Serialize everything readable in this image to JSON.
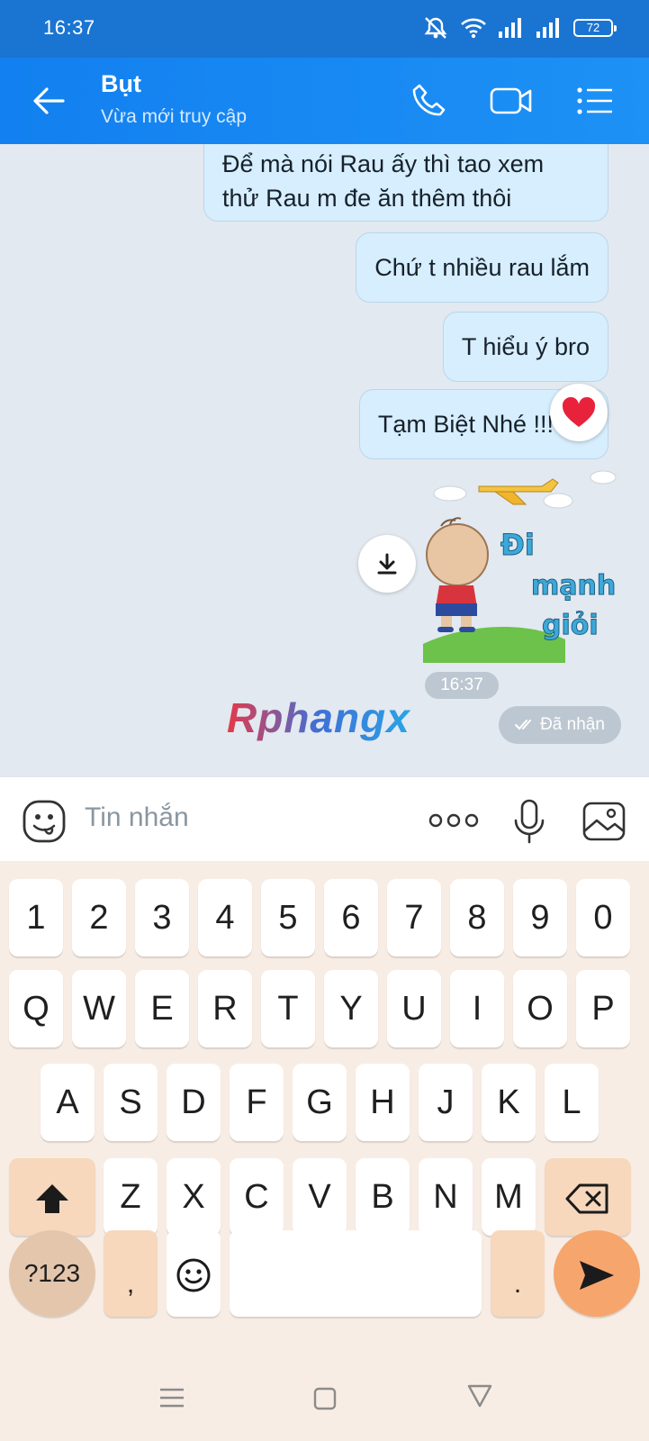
{
  "status_bar": {
    "time": "16:37",
    "battery": "72"
  },
  "header": {
    "contact_name": "Bụt",
    "status": "Vừa mới truy cập"
  },
  "messages": [
    {
      "lines": [
        "Để mà nói Rau ấy thì tao xem",
        "thử Rau m đe ăn thêm thôi"
      ]
    },
    {
      "text": "Chứ t nhiều rau lắm"
    },
    {
      "text": "T hiểu ý bro"
    },
    {
      "text": "Tạm Biệt Nhé !!!"
    }
  ],
  "sticker": {
    "text_lines": [
      "Đi",
      "mạnh",
      "giỏi"
    ]
  },
  "message_time": "16:37",
  "delivery_status": "Đã nhận",
  "watermark": "Rphangx",
  "input": {
    "placeholder": "Tin nhắn"
  },
  "keyboard": {
    "row_numbers": [
      "1",
      "2",
      "3",
      "4",
      "5",
      "6",
      "7",
      "8",
      "9",
      "0"
    ],
    "row_1": [
      "Q",
      "W",
      "E",
      "R",
      "T",
      "Y",
      "U",
      "I",
      "O",
      "P"
    ],
    "row_2": [
      "A",
      "S",
      "D",
      "F",
      "G",
      "H",
      "J",
      "K",
      "L"
    ],
    "row_3": [
      "Z",
      "X",
      "C",
      "V",
      "B",
      "N",
      "M"
    ],
    "symbols_key": "?123",
    "comma_key": ",",
    "period_key": "."
  },
  "colors": {
    "header": "#1a80f0",
    "bubble": "#d6eefd",
    "keyboard_bg": "#f8ede4",
    "function_key": "#f7d8bd"
  }
}
